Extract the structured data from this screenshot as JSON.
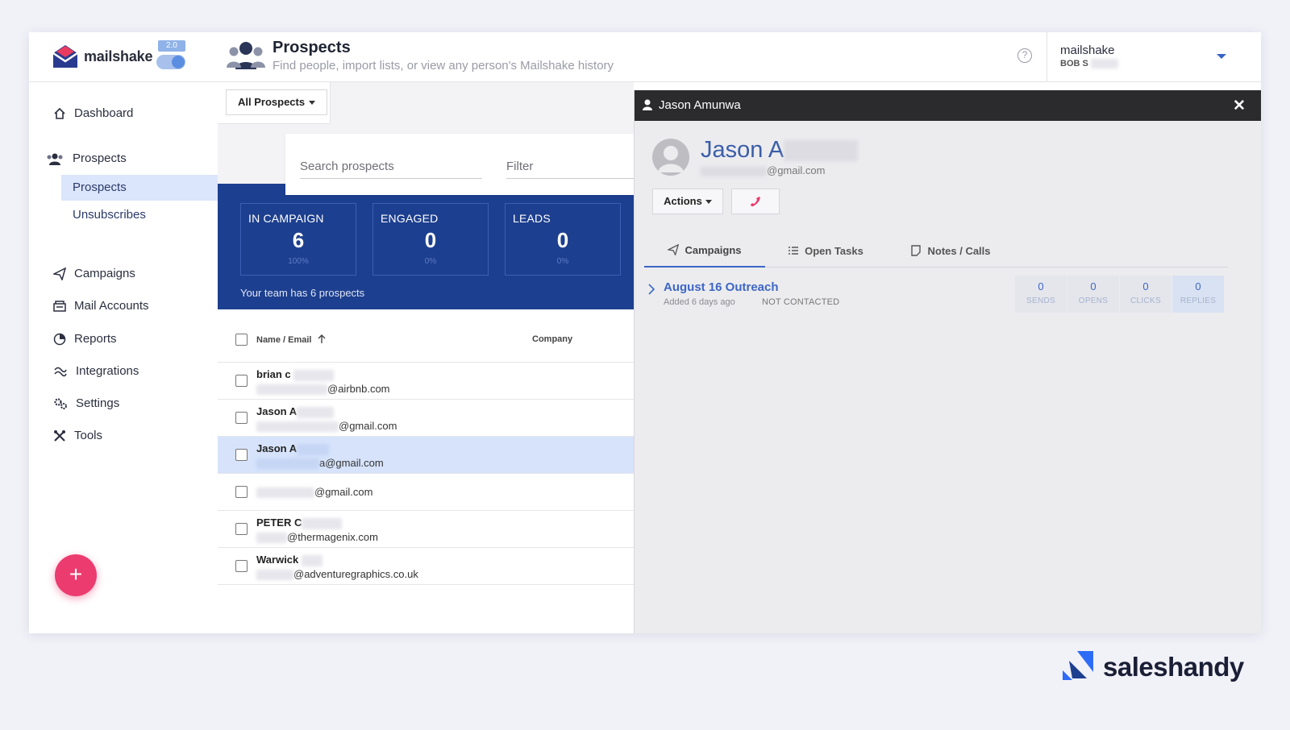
{
  "header": {
    "logo_text": "mailshake",
    "version_badge": "2.0",
    "page_title": "Prospects",
    "page_subtitle": "Find people, import lists, or view any person's Mailshake history",
    "help_glyph": "?",
    "account_name": "mailshake",
    "account_user": "BOB S"
  },
  "sidebar": {
    "items": [
      {
        "label": "Dashboard",
        "icon": "home-icon"
      },
      {
        "label": "Prospects",
        "icon": "people-icon"
      },
      {
        "label": "Campaigns",
        "icon": "send-icon"
      },
      {
        "label": "Mail Accounts",
        "icon": "mailbox-icon"
      },
      {
        "label": "Reports",
        "icon": "pie-chart-icon"
      },
      {
        "label": "Integrations",
        "icon": "integrations-icon"
      },
      {
        "label": "Settings",
        "icon": "gears-icon"
      },
      {
        "label": "Tools",
        "icon": "tools-icon"
      }
    ],
    "sub_items": [
      {
        "label": "Prospects",
        "active": true
      },
      {
        "label": "Unsubscribes",
        "active": false
      }
    ],
    "fab_label": "+"
  },
  "main": {
    "list_filter": "All Prospects",
    "search_placeholder": "Search prospects",
    "filter_placeholder": "Filter",
    "stats": [
      {
        "label": "IN CAMPAIGN",
        "value": "6",
        "pct": "100%"
      },
      {
        "label": "ENGAGED",
        "value": "0",
        "pct": "0%"
      },
      {
        "label": "LEADS",
        "value": "0",
        "pct": "0%"
      }
    ],
    "team_note": "Your team has 6 prospects",
    "columns": {
      "name": "Name / Email",
      "company": "Company"
    },
    "rows": [
      {
        "name": "brian c",
        "email": "@airbnb.com",
        "selected": false
      },
      {
        "name": "Jason A",
        "email": "@gmail.com",
        "selected": false
      },
      {
        "name": "Jason A",
        "email": "a@gmail.com",
        "selected": true
      },
      {
        "name": "",
        "email": "@gmail.com",
        "selected": false
      },
      {
        "name": "PETER C",
        "email": "@thermagenix.com",
        "selected": false
      },
      {
        "name": "Warwick",
        "email": "@adventuregraphics.co.uk",
        "selected": false
      }
    ]
  },
  "panel": {
    "title": "Jason Amunwa",
    "close_glyph": "✕",
    "person_name": "Jason A",
    "person_email": "@gmail.com",
    "actions_label": "Actions",
    "tabs": [
      {
        "label": "Campaigns",
        "icon": "send-icon",
        "active": true
      },
      {
        "label": "Open Tasks",
        "icon": "checklist-icon",
        "active": false
      },
      {
        "label": "Notes / Calls",
        "icon": "note-icon",
        "active": false
      }
    ],
    "campaign": {
      "name": "August 16 Outreach",
      "added": "Added 6 days ago",
      "status": "NOT CONTACTED",
      "metrics": [
        {
          "value": "0",
          "label": "SENDS"
        },
        {
          "value": "0",
          "label": "OPENS"
        },
        {
          "value": "0",
          "label": "CLICKS"
        },
        {
          "value": "0",
          "label": "REPLIES"
        }
      ]
    }
  },
  "brand": {
    "name": "saleshandy"
  },
  "colors": {
    "primary_navy": "#1d3f8f",
    "accent_pink": "#ec3b6f",
    "link_blue": "#3d66c4",
    "selected_row": "#d6e3fb",
    "panel_header": "#2b2b2e"
  }
}
